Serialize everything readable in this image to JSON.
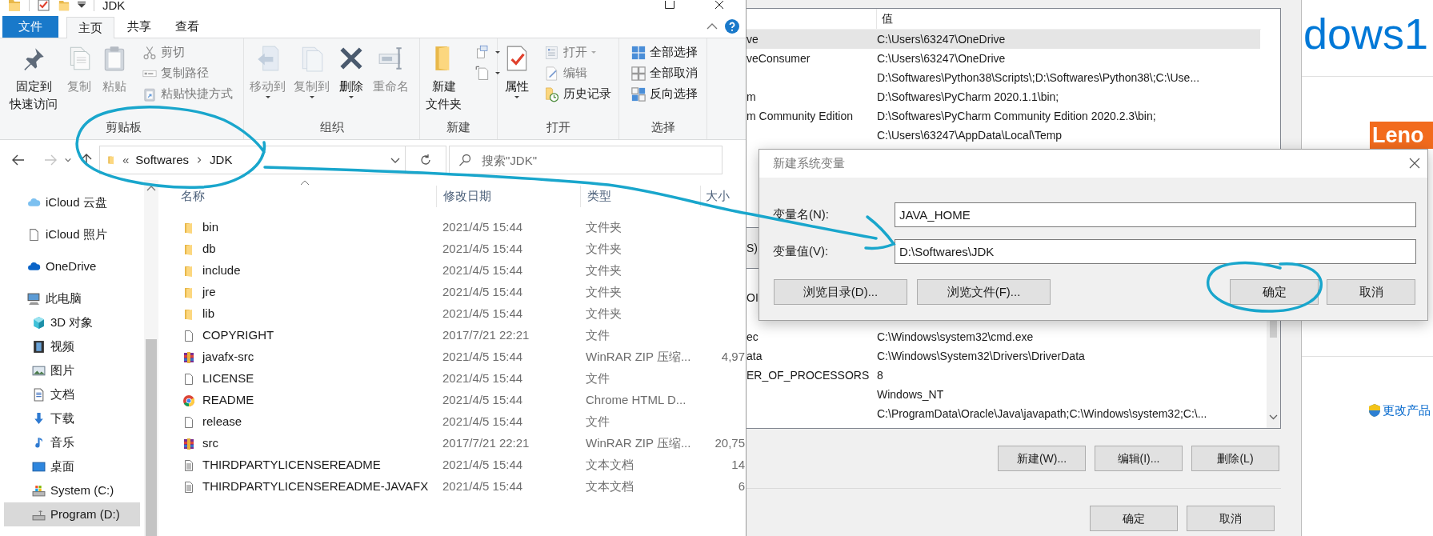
{
  "explorer": {
    "title": "JDK",
    "ribbon_tabs": [
      {
        "label": "文件",
        "kind": "menu",
        "selected": false
      },
      {
        "label": "主页",
        "kind": "tab",
        "selected": true
      },
      {
        "label": "共享",
        "kind": "tab",
        "selected": false
      },
      {
        "label": "查看",
        "kind": "tab",
        "selected": false
      }
    ],
    "ribbon_groups": [
      {
        "label": "剪贴板",
        "commands": [
          {
            "kind": "pin",
            "lines": [
              "固定到",
              "快速访问"
            ],
            "disabled": false
          },
          {
            "kind": "copy",
            "lines": [
              "复制"
            ],
            "disabled": true
          },
          {
            "kind": "paste",
            "lines": [
              "粘贴"
            ],
            "disabled": true
          },
          {
            "kind": "cut",
            "lines": [
              "剪切"
            ],
            "disabled": true
          },
          {
            "kind": "copy-path",
            "lines": [
              "复制路径"
            ],
            "disabled": true
          },
          {
            "kind": "paste-shortcut",
            "lines": [
              "粘贴快捷方式"
            ],
            "disabled": true
          }
        ]
      },
      {
        "label": "组织",
        "commands": [
          {
            "kind": "move-to",
            "lines": [
              "移动到"
            ],
            "disabled": true,
            "dropdown": true
          },
          {
            "kind": "copy-to",
            "lines": [
              "复制到"
            ],
            "disabled": true,
            "dropdown": true
          },
          {
            "kind": "delete",
            "lines": [
              "删除"
            ],
            "disabled": false,
            "dropdown": true
          },
          {
            "kind": "rename",
            "lines": [
              "重命名"
            ],
            "disabled": true
          }
        ]
      },
      {
        "label": "新建",
        "commands": [
          {
            "kind": "new-folder",
            "lines": [
              "新建",
              "文件夹"
            ],
            "disabled": false
          },
          {
            "kind": "new-item",
            "disabled": false,
            "dropdown": true
          },
          {
            "kind": "easy-access",
            "disabled": false,
            "dropdown": true
          }
        ]
      },
      {
        "label": "打开",
        "commands": [
          {
            "kind": "properties",
            "lines": [
              "属性"
            ],
            "disabled": false,
            "dropdown": true
          },
          {
            "kind": "open",
            "lines": [
              "打开"
            ],
            "disabled": true,
            "dropdown": true
          },
          {
            "kind": "edit",
            "lines": [
              "编辑"
            ],
            "disabled": true
          },
          {
            "kind": "history",
            "lines": [
              "历史记录"
            ],
            "disabled": false
          }
        ]
      },
      {
        "label": "选择",
        "commands": [
          {
            "kind": "select-all",
            "lines": [
              "全部选择"
            ],
            "disabled": false
          },
          {
            "kind": "select-none",
            "lines": [
              "全部取消"
            ],
            "disabled": false
          },
          {
            "kind": "invert",
            "lines": [
              "反向选择"
            ],
            "disabled": false
          }
        ]
      }
    ],
    "back_disabled": false,
    "forward_disabled": true,
    "overflow_mark": "«",
    "breadcrumb": [
      "Softwares",
      "JDK"
    ],
    "search": {
      "placeholder": "搜索\"JDK\""
    },
    "sidebar": [
      {
        "kind": "cloud",
        "label": "iCloud 云盘",
        "selected": false
      },
      {
        "kind": "page",
        "label": "iCloud 照片",
        "selected": false
      },
      {
        "kind": "onedrive",
        "label": "OneDrive",
        "selected": false
      },
      {
        "kind": "pc",
        "label": "此电脑",
        "selected": false,
        "children": [
          {
            "kind": "cube",
            "label": "3D 对象",
            "selected": false
          },
          {
            "kind": "video",
            "label": "视频",
            "selected": false
          },
          {
            "kind": "pictures",
            "label": "图片",
            "selected": false
          },
          {
            "kind": "documents",
            "label": "文档",
            "selected": false
          },
          {
            "kind": "downloads",
            "label": "下载",
            "selected": false
          },
          {
            "kind": "music",
            "label": "音乐",
            "selected": false
          },
          {
            "kind": "desktop",
            "label": "桌面",
            "selected": false
          },
          {
            "kind": "system-drive",
            "label": "System (C:)",
            "selected": false
          },
          {
            "kind": "drive",
            "label": "Program (D:)",
            "selected": true
          }
        ]
      }
    ],
    "columns": [
      "名称",
      "修改日期",
      "类型",
      "大小"
    ],
    "files": [
      {
        "kind": "folder",
        "name": "bin",
        "date": "2021/4/5 15:44",
        "type": "文件夹"
      },
      {
        "kind": "folder",
        "name": "db",
        "date": "2021/4/5 15:44",
        "type": "文件夹"
      },
      {
        "kind": "folder",
        "name": "include",
        "date": "2021/4/5 15:44",
        "type": "文件夹"
      },
      {
        "kind": "folder",
        "name": "jre",
        "date": "2021/4/5 15:44",
        "type": "文件夹"
      },
      {
        "kind": "folder",
        "name": "lib",
        "date": "2021/4/5 15:44",
        "type": "文件夹"
      },
      {
        "kind": "file",
        "name": "COPYRIGHT",
        "date": "2017/7/21 22:21",
        "type": "文件"
      },
      {
        "kind": "archive",
        "name": "javafx-src",
        "date": "2021/4/5 15:44",
        "type": "WinRAR ZIP 压缩...",
        "size": "4,97"
      },
      {
        "kind": "file",
        "name": "LICENSE",
        "date": "2021/4/5 15:44",
        "type": "文件"
      },
      {
        "kind": "chrome",
        "name": "README",
        "date": "2021/4/5 15:44",
        "type": "Chrome HTML D..."
      },
      {
        "kind": "file",
        "name": "release",
        "date": "2021/4/5 15:44",
        "type": "文件"
      },
      {
        "kind": "archive",
        "name": "src",
        "date": "2017/7/21 22:21",
        "type": "WinRAR ZIP 压缩...",
        "size": "20,75"
      },
      {
        "kind": "text",
        "name": "THIRDPARTYLICENSEREADME",
        "date": "2021/4/5 15:44",
        "type": "文本文档",
        "size": "14"
      },
      {
        "kind": "text",
        "name": "THIRDPARTYLICENSEREADME-JAVAFX",
        "date": "2021/4/5 15:44",
        "type": "文本文档",
        "size": "6"
      }
    ]
  },
  "env_window": {
    "value_header": "值",
    "upper_rows": [
      {
        "name": "ve",
        "value": "C:\\Users\\63247\\OneDrive",
        "selected": true
      },
      {
        "name": "veConsumer",
        "value": "C:\\Users\\63247\\OneDrive",
        "selected": false
      },
      {
        "value": "D:\\Softwares\\Python38\\Scripts\\;D:\\Softwares\\Python38\\;C:\\Use...",
        "selected": false
      },
      {
        "name": "m",
        "value": "D:\\Softwares\\PyCharm 2020.1.1\\bin;",
        "selected": false
      },
      {
        "name": "m Community Edition",
        "value": "D:\\Softwares\\PyCharm Community Edition 2020.2.3\\bin;",
        "selected": false
      },
      {
        "value": "C:\\Users\\63247\\AppData\\Local\\Temp",
        "selected": false
      }
    ],
    "label_fragment": "S)",
    "hidden_row_name": "OI",
    "lower_rows": [
      {
        "name": "ec",
        "value": "C:\\Windows\\system32\\cmd.exe",
        "selected": false
      },
      {
        "name": "ata",
        "value": "C:\\Windows\\System32\\Drivers\\DriverData",
        "selected": false
      },
      {
        "name": "ER_OF_PROCESSORS",
        "value": "8",
        "selected": false
      },
      {
        "value": "Windows_NT",
        "selected": false
      },
      {
        "value": "C:\\ProgramData\\Oracle\\Java\\javapath;C:\\Windows\\system32;C:\\...",
        "selected": false
      }
    ],
    "list_buttons": [
      "新建(W)...",
      "编辑(I)...",
      "删除(L)"
    ],
    "buttons": [
      "确定",
      "取消"
    ]
  },
  "system_panel": {
    "heading": "dows1",
    "brand": "Leno",
    "link": "更改产品"
  },
  "dialog": {
    "title": "新建系统变量",
    "fields": [
      {
        "label": "变量名(N):",
        "value": "JAVA_HOME"
      },
      {
        "label": "变量值(V):",
        "value": "D:\\Softwares\\JDK"
      }
    ],
    "left_buttons": [
      "浏览目录(D)...",
      "浏览文件(F)..."
    ],
    "buttons": [
      "确定",
      "取消"
    ]
  }
}
